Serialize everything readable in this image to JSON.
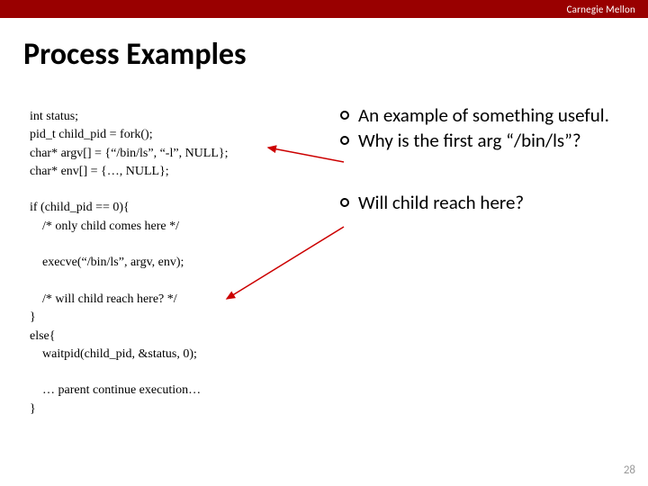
{
  "topbar": {
    "brand": "Carnegie Mellon"
  },
  "title": "Process Examples",
  "code": {
    "l1": "int status;",
    "l2": "pid_t child_pid = fork();",
    "l3": "char* argv[] = {“/bin/ls”, “-l”, NULL};",
    "l4": "char* env[] = {…, NULL};",
    "l5": "",
    "l6": "if (child_pid == 0){",
    "l7": "    /* only child comes here */",
    "l8": "",
    "l9": "    execve(“/bin/ls”, argv, env);",
    "l10": "",
    "l11": "    /* will child reach here? */",
    "l12": "}",
    "l13": "else{",
    "l14": "    waitpid(child_pid, &status, 0);",
    "l15": "",
    "l16": "    … parent continue execution…",
    "l17": "}"
  },
  "bullets": {
    "b1": "An example of something useful.",
    "b2": "Why is the first arg “/bin/ls”?",
    "b3": "Will child reach here?"
  },
  "page_number": "28"
}
